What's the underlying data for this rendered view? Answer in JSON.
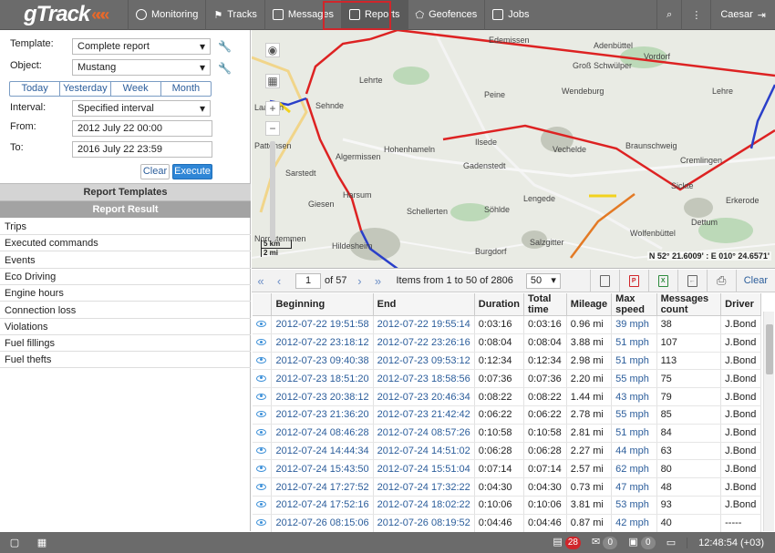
{
  "app": {
    "logo": "gTrack",
    "logo_chevrons": "«««"
  },
  "nav": {
    "items": [
      {
        "name": "monitoring",
        "label": "Monitoring",
        "icon": "globe-icon"
      },
      {
        "name": "tracks",
        "label": "Tracks",
        "icon": "flag-icon"
      },
      {
        "name": "messages",
        "label": "Messages",
        "icon": "list-icon"
      },
      {
        "name": "reports",
        "label": "Reports",
        "icon": "chart-icon",
        "active": true
      },
      {
        "name": "geofences",
        "label": "Geofences",
        "icon": "shape-icon"
      },
      {
        "name": "jobs",
        "label": "Jobs",
        "icon": "checklist-icon"
      }
    ],
    "user": "Caesar"
  },
  "form": {
    "template_label": "Template:",
    "template_value": "Complete report",
    "object_label": "Object:",
    "object_value": "Mustang",
    "periods": [
      "Today",
      "Yesterday",
      "Week",
      "Month"
    ],
    "interval_label": "Interval:",
    "interval_value": "Specified interval",
    "from_label": "From:",
    "from_value": "2012 July 22 00:00",
    "to_label": "To:",
    "to_value": "2016 July 22 23:59",
    "clear": "Clear",
    "execute": "Execute"
  },
  "sections": {
    "templates": "Report Templates",
    "result": "Report Result"
  },
  "result_items": [
    "Trips",
    "Executed commands",
    "Events",
    "Eco Driving",
    "Engine hours",
    "Connection loss",
    "Violations",
    "Fuel fillings",
    "Fuel thefts"
  ],
  "map": {
    "places": [
      {
        "n": "Lehrte"
      },
      {
        "n": "Edemissen"
      },
      {
        "n": "Adenbüttel"
      },
      {
        "n": "Vordorf"
      },
      {
        "n": "Groß Schwülper"
      },
      {
        "n": "Peine"
      },
      {
        "n": "Wendeburg"
      },
      {
        "n": "Lehre"
      },
      {
        "n": "Sehnde"
      },
      {
        "n": "Hohenhameln"
      },
      {
        "n": "Ilsede"
      },
      {
        "n": "Vechelde"
      },
      {
        "n": "Braunschweig"
      },
      {
        "n": "Algermissen"
      },
      {
        "n": "Gadenstedt"
      },
      {
        "n": "Cremlingen"
      },
      {
        "n": "Sarstedt"
      },
      {
        "n": "Lengede"
      },
      {
        "n": "Sickte"
      },
      {
        "n": "Giesen"
      },
      {
        "n": "Harsum"
      },
      {
        "n": "Schellerten"
      },
      {
        "n": "Söhlde"
      },
      {
        "n": "Erkerode"
      },
      {
        "n": "Wolfenbüttel"
      },
      {
        "n": "Dettum"
      },
      {
        "n": "Hildesheim"
      },
      {
        "n": "Burgdorf"
      },
      {
        "n": "Salzgitter"
      },
      {
        "n": "Laatzen"
      },
      {
        "n": "Pattensen"
      },
      {
        "n": "Nordstemmen"
      }
    ],
    "coords": "N 52° 21.6009' : E 010° 24.6571'",
    "scale_km": "5 km",
    "scale_mi": "2 mi"
  },
  "table": {
    "page": "1",
    "of_pages": "of 57",
    "items_info": "Items from 1 to 50 of 2806",
    "page_size": "50",
    "clear": "Clear",
    "headers": [
      "Beginning",
      "End",
      "Duration",
      "Total time",
      "Mileage",
      "Max speed",
      "Messages count",
      "Driver"
    ],
    "rows": [
      [
        "2012-07-22 19:51:58",
        "2012-07-22 19:55:14",
        "0:03:16",
        "0:03:16",
        "0.96 mi",
        "39 mph",
        "38",
        "J.Bond"
      ],
      [
        "2012-07-22 23:18:12",
        "2012-07-22 23:26:16",
        "0:08:04",
        "0:08:04",
        "3.88 mi",
        "51 mph",
        "107",
        "J.Bond"
      ],
      [
        "2012-07-23 09:40:38",
        "2012-07-23 09:53:12",
        "0:12:34",
        "0:12:34",
        "2.98 mi",
        "51 mph",
        "113",
        "J.Bond"
      ],
      [
        "2012-07-23 18:51:20",
        "2012-07-23 18:58:56",
        "0:07:36",
        "0:07:36",
        "2.20 mi",
        "55 mph",
        "75",
        "J.Bond"
      ],
      [
        "2012-07-23 20:38:12",
        "2012-07-23 20:46:34",
        "0:08:22",
        "0:08:22",
        "1.44 mi",
        "43 mph",
        "79",
        "J.Bond"
      ],
      [
        "2012-07-23 21:36:20",
        "2012-07-23 21:42:42",
        "0:06:22",
        "0:06:22",
        "2.78 mi",
        "55 mph",
        "85",
        "J.Bond"
      ],
      [
        "2012-07-24 08:46:28",
        "2012-07-24 08:57:26",
        "0:10:58",
        "0:10:58",
        "2.81 mi",
        "51 mph",
        "84",
        "J.Bond"
      ],
      [
        "2012-07-24 14:44:34",
        "2012-07-24 14:51:02",
        "0:06:28",
        "0:06:28",
        "2.27 mi",
        "44 mph",
        "63",
        "J.Bond"
      ],
      [
        "2012-07-24 15:43:50",
        "2012-07-24 15:51:04",
        "0:07:14",
        "0:07:14",
        "2.57 mi",
        "62 mph",
        "80",
        "J.Bond"
      ],
      [
        "2012-07-24 17:27:52",
        "2012-07-24 17:32:22",
        "0:04:30",
        "0:04:30",
        "0.73 mi",
        "47 mph",
        "48",
        "J.Bond"
      ],
      [
        "2012-07-24 17:52:16",
        "2012-07-24 18:02:22",
        "0:10:06",
        "0:10:06",
        "3.81 mi",
        "53 mph",
        "93",
        "J.Bond"
      ],
      [
        "2012-07-26 08:15:06",
        "2012-07-26 08:19:52",
        "0:04:46",
        "0:04:46",
        "0.87 mi",
        "42 mph",
        "40",
        "-----"
      ]
    ]
  },
  "status": {
    "notifications": "28",
    "messages": "0",
    "photos": "0",
    "time": "12:48:54 (+03)"
  },
  "colors": {
    "accent": "#2f86d6",
    "topbar": "#6b6b6b",
    "highlight": "#d0262b",
    "logo_chevron": "#e8692a"
  }
}
